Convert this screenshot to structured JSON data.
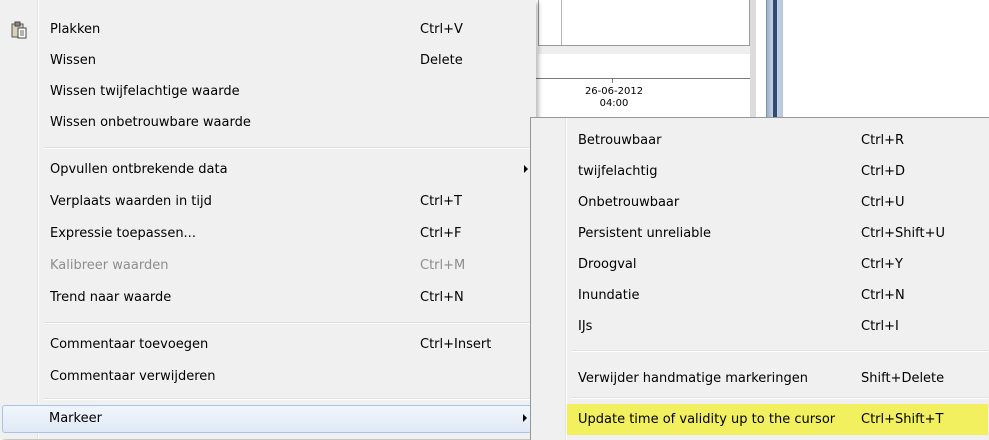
{
  "background": {
    "date_line1": "26-06-2012",
    "date_line2": "04:00"
  },
  "menu": {
    "items": [
      {
        "label": "Plakken",
        "shortcut": "Ctrl+V"
      },
      {
        "label": "Wissen",
        "shortcut": "Delete"
      },
      {
        "label": "Wissen twijfelachtige waarde",
        "shortcut": ""
      },
      {
        "label": "Wissen onbetrouwbare waarde",
        "shortcut": ""
      },
      {
        "label": "Opvullen ontbrekende data",
        "shortcut": ""
      },
      {
        "label": "Verplaats waarden in tijd",
        "shortcut": "Ctrl+T"
      },
      {
        "label": "Expressie toepassen...",
        "shortcut": "Ctrl+F"
      },
      {
        "label": "Kalibreer waarden",
        "shortcut": "Ctrl+M"
      },
      {
        "label": "Trend naar waarde",
        "shortcut": "Ctrl+N"
      },
      {
        "label": "Commentaar toevoegen",
        "shortcut": "Ctrl+Insert"
      },
      {
        "label": "Commentaar verwijderen",
        "shortcut": ""
      },
      {
        "label": "Markeer",
        "shortcut": ""
      }
    ]
  },
  "submenu": {
    "items": [
      {
        "label": "Betrouwbaar",
        "shortcut": "Ctrl+R"
      },
      {
        "label": "twijfelachtig",
        "shortcut": "Ctrl+D"
      },
      {
        "label": "Onbetrouwbaar",
        "shortcut": "Ctrl+U"
      },
      {
        "label": "Persistent unreliable",
        "shortcut": "Ctrl+Shift+U"
      },
      {
        "label": "Droogval",
        "shortcut": "Ctrl+Y"
      },
      {
        "label": "Inundatie",
        "shortcut": "Ctrl+N"
      },
      {
        "label": "IJs",
        "shortcut": "Ctrl+I"
      },
      {
        "label": "Verwijder handmatige markeringen",
        "shortcut": "Shift+Delete"
      },
      {
        "label": "Update time of validity up to the cursor",
        "shortcut": "Ctrl+Shift+T"
      }
    ],
    "highlight_color": "#f3f060"
  }
}
